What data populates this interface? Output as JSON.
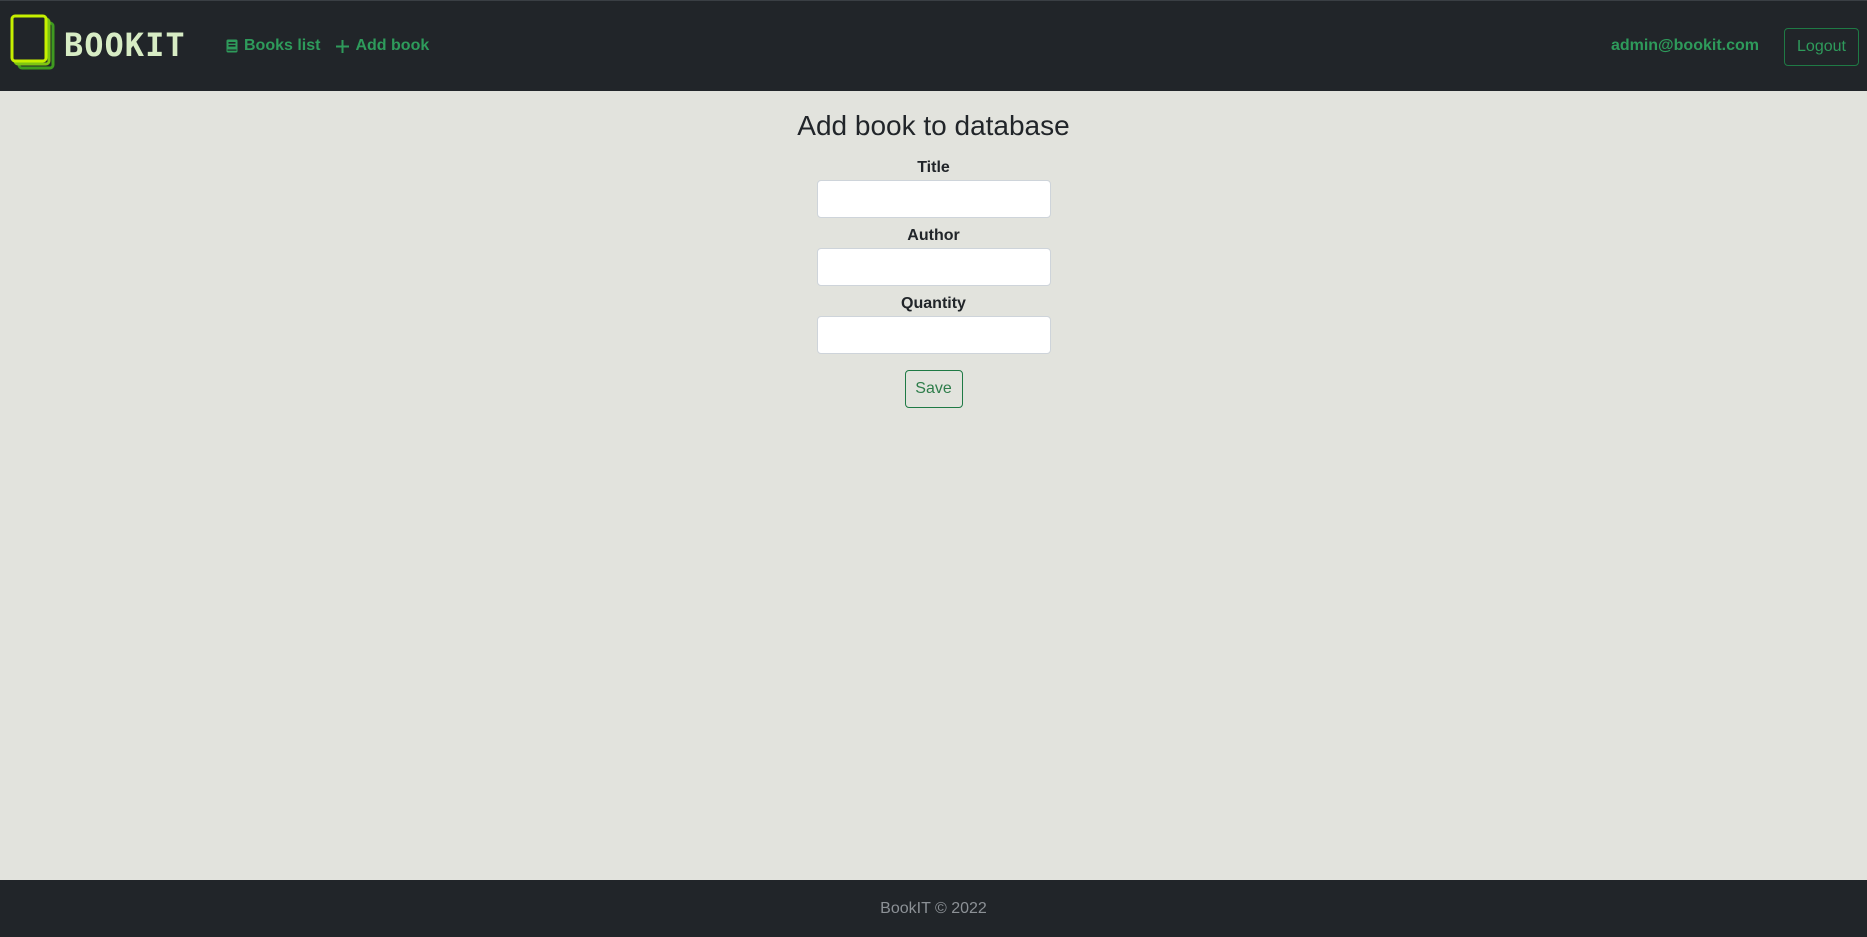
{
  "navbar": {
    "brand_text": "BOOKIT",
    "brand_icon": "book-stack-logo",
    "links": [
      {
        "label": "Books list",
        "icon": "book-icon"
      },
      {
        "label": "Add book",
        "icon": "plus-icon"
      }
    ],
    "user_email": "admin@bookit.com",
    "logout_label": "Logout"
  },
  "main": {
    "title": "Add book to database",
    "fields": [
      {
        "label": "Title",
        "value": "",
        "placeholder": ""
      },
      {
        "label": "Author",
        "value": "",
        "placeholder": ""
      },
      {
        "label": "Quantity",
        "value": "",
        "placeholder": ""
      }
    ],
    "save_label": "Save"
  },
  "footer": {
    "text": "BookIT © 2022"
  },
  "colors": {
    "navbar_bg": "#212529",
    "page_bg": "#e2e3dd",
    "accent_green": "#2e9b5b",
    "logo_lime": "#c6f000"
  }
}
